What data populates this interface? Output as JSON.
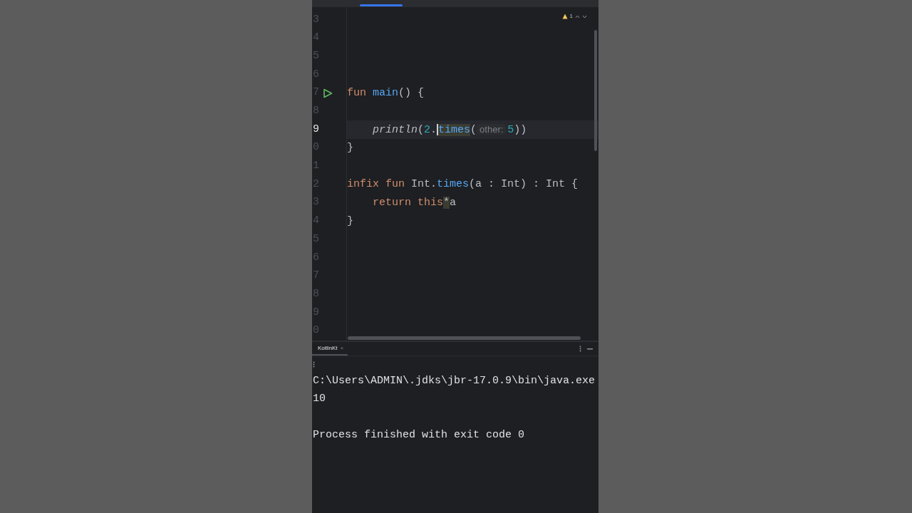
{
  "editor": {
    "problems": {
      "count": "1"
    },
    "lines": [
      {
        "number": "3",
        "current": false
      },
      {
        "number": "4",
        "current": false
      },
      {
        "number": "5",
        "current": false
      },
      {
        "number": "6",
        "current": false
      },
      {
        "number": "7",
        "current": false,
        "run_marker": true,
        "tokens": [
          {
            "kind": "keyword",
            "text": "fun "
          },
          {
            "kind": "declaration",
            "text": "main"
          },
          {
            "kind": "plain",
            "text": "() {"
          }
        ]
      },
      {
        "number": "8",
        "current": false
      },
      {
        "number": "9",
        "current": true,
        "indented": true,
        "tokens": [
          {
            "kind": "call",
            "text": "println"
          },
          {
            "kind": "plain",
            "text": "("
          },
          {
            "kind": "number",
            "text": "2"
          },
          {
            "kind": "plain",
            "text": "."
          },
          {
            "kind": "member",
            "text": "times",
            "highlighted": true,
            "caret_before": true
          },
          {
            "kind": "plain",
            "text": "("
          },
          {
            "kind": "hint",
            "text": "other:"
          },
          {
            "kind": "number",
            "text": "5"
          },
          {
            "kind": "plain",
            "text": "))"
          }
        ]
      },
      {
        "number": "0",
        "current": false,
        "tokens": [
          {
            "kind": "plain",
            "text": "}"
          }
        ]
      },
      {
        "number": "1",
        "current": false
      },
      {
        "number": "2",
        "current": false,
        "tokens": [
          {
            "kind": "keyword",
            "text": "infix fun "
          },
          {
            "kind": "plain",
            "text": "Int."
          },
          {
            "kind": "declaration",
            "text": "times"
          },
          {
            "kind": "plain",
            "text": "(a : Int) : Int {"
          }
        ]
      },
      {
        "number": "3",
        "current": false,
        "indented": true,
        "tokens": [
          {
            "kind": "keyword",
            "text": "return this"
          },
          {
            "kind": "plain",
            "text": "*",
            "highlighted": true
          },
          {
            "kind": "plain",
            "text": "a"
          }
        ]
      },
      {
        "number": "4",
        "current": false,
        "tokens": [
          {
            "kind": "plain",
            "text": "}"
          }
        ]
      },
      {
        "number": "5",
        "current": false
      },
      {
        "number": "6",
        "current": false
      },
      {
        "number": "7",
        "current": false
      },
      {
        "number": "8",
        "current": false
      },
      {
        "number": "9",
        "current": false
      },
      {
        "number": "0",
        "current": false
      }
    ]
  },
  "run_panel": {
    "tab": {
      "label": "KotlinKt",
      "close": "×"
    },
    "output": [
      {
        "kind": "text",
        "text": "C:\\Users\\ADMIN\\.jdks\\jbr-17.0.9\\bin\\java.exe"
      },
      {
        "kind": "text",
        "text": "10"
      },
      {
        "kind": "blank"
      },
      {
        "kind": "text",
        "text": "Process finished with exit code 0"
      }
    ]
  }
}
